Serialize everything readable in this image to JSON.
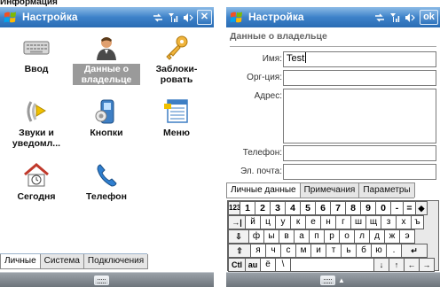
{
  "caption": "Информация",
  "left": {
    "title": "Настройка",
    "close_label": "✕",
    "items": [
      {
        "label": "Ввод",
        "icon": "keyboard-icon",
        "selected": false
      },
      {
        "label": "Данные о владельце",
        "icon": "owner-info-icon",
        "selected": true
      },
      {
        "label": "Заблоки-ровать",
        "icon": "lock-key-icon",
        "selected": false
      },
      {
        "label": "Звуки и уведомл...",
        "icon": "sounds-icon",
        "selected": false
      },
      {
        "label": "Кнопки",
        "icon": "buttons-icon",
        "selected": false
      },
      {
        "label": "Меню",
        "icon": "menu-icon",
        "selected": false
      },
      {
        "label": "Сегодня",
        "icon": "today-icon",
        "selected": false
      },
      {
        "label": "Телефон",
        "icon": "phone-icon",
        "selected": false
      }
    ],
    "tabs": [
      "Личные",
      "Система",
      "Подключения"
    ],
    "active_tab": "Личные"
  },
  "right": {
    "title": "Настройка",
    "ok_label": "ok",
    "subtitle": "Данные о владельце",
    "fields": {
      "name": {
        "label": "Имя:",
        "value": "Test"
      },
      "org": {
        "label": "Орг-ция:",
        "value": ""
      },
      "address": {
        "label": "Адрес:",
        "value": ""
      },
      "phone": {
        "label": "Телефон:",
        "value": ""
      },
      "email": {
        "label": "Эл. почта:",
        "value": ""
      }
    },
    "tabs": [
      "Личные данные",
      "Примечания",
      "Параметры"
    ],
    "active_tab": "Личные данные",
    "keyboard": {
      "row1": [
        "123",
        "1",
        "2",
        "3",
        "4",
        "5",
        "6",
        "7",
        "8",
        "9",
        "0",
        "-",
        "=",
        "◆"
      ],
      "row2": [
        "→|",
        "й",
        "ц",
        "у",
        "к",
        "е",
        "н",
        "г",
        "ш",
        "щ",
        "з",
        "х",
        "ъ"
      ],
      "row3": [
        "⇩",
        "ф",
        "ы",
        "в",
        "а",
        "п",
        "р",
        "о",
        "л",
        "д",
        "ж",
        "э"
      ],
      "row4": [
        "⇧",
        "я",
        "ч",
        "с",
        "м",
        "и",
        "т",
        "ь",
        "б",
        "ю",
        ".",
        "↵"
      ],
      "row5": [
        "Ctl",
        "au",
        "ё",
        "\\",
        "",
        "↓",
        "↑",
        "←",
        "→"
      ]
    }
  },
  "colors": {
    "titlebar": "#3d82c9",
    "menubar": "#6d747b",
    "selection": "#9a9a9a"
  }
}
